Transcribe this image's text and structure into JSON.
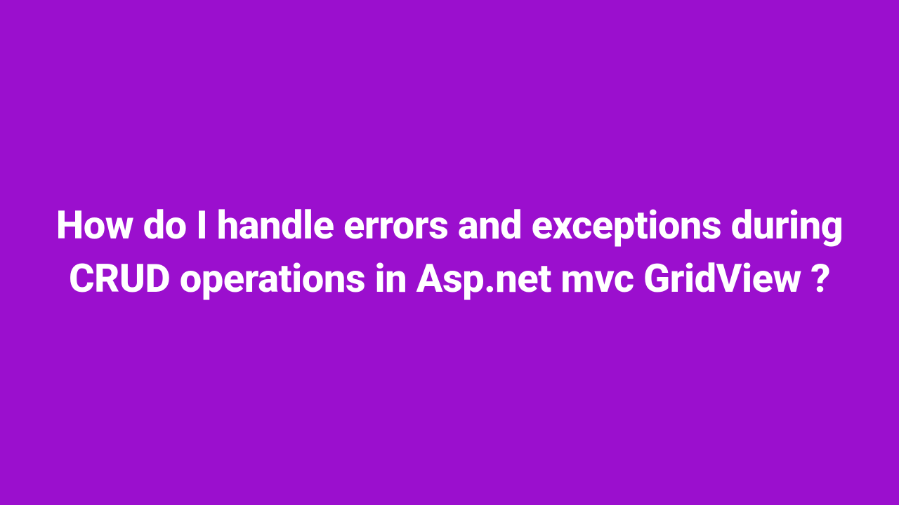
{
  "heading": "How do I handle errors and exceptions during CRUD operations in Asp.net mvc GridView ?",
  "colors": {
    "background": "#9b0fce",
    "text": "#ffffff"
  }
}
